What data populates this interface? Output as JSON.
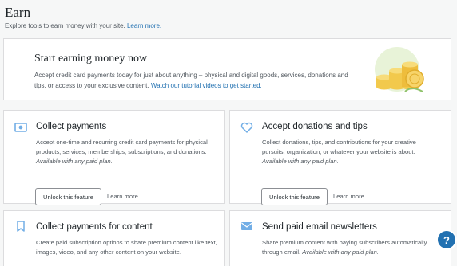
{
  "header": {
    "title": "Earn",
    "subtitle": "Explore tools to earn money with your site.",
    "subtitle_link": "Learn more."
  },
  "hero": {
    "title": "Start earning money now",
    "text": "Accept credit card payments today for just about anything – physical and digital goods, services, donations and tips, or access to your exclusive content.",
    "link": "Watch our tutorial videos to get started."
  },
  "cards": [
    {
      "title": "Collect payments",
      "text": "Accept one-time and recurring credit card payments for physical products, services, memberships, subscriptions, and donations.",
      "note": "Available with any paid plan.",
      "button": "Unlock this feature",
      "learn": "Learn more"
    },
    {
      "title": "Accept donations and tips",
      "text": "Collect donations, tips, and contributions for your creative pursuits, organization, or whatever your website is about.",
      "note": "Available with any paid plan.",
      "button": "Unlock this feature",
      "learn": "Learn more"
    },
    {
      "title": "Collect payments for content",
      "text": "Create paid subscription options to share premium content like text, images, video, and any other content on your website."
    },
    {
      "title": "Send paid email newsletters",
      "text": "Share premium content with paying subscribers automatically through email.",
      "note": "Available with any paid plan."
    }
  ],
  "help": {
    "label": "?"
  },
  "colors": {
    "accent": "#2271b1",
    "icon": "#72aee6",
    "background": "#f6f7f7"
  }
}
